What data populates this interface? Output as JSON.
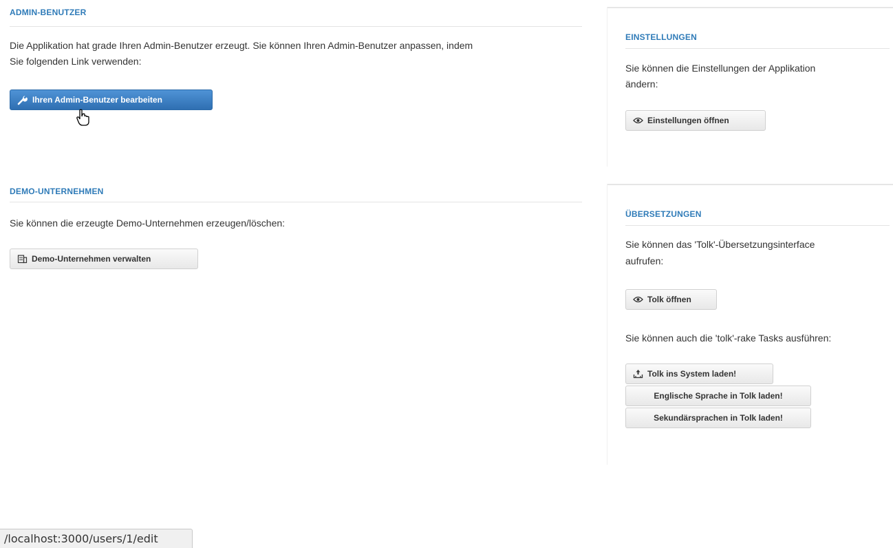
{
  "admin_section": {
    "title": "ADMIN-BENUTZER",
    "text_line1": "Die Applikation hat grade Ihren Admin-Benutzer erzeugt. Sie können Ihren Admin-Benutzer anpassen, indem",
    "text_line2": "Sie folgenden Link verwenden:",
    "button_label": "Ihren Admin-Benutzer bearbeiten",
    "button_icon": "wrench-icon"
  },
  "demo_section": {
    "title": "DEMO-UNTERNEHMEN",
    "text": "Sie können die erzeugte Demo-Unternehmen erzeugen/löschen:",
    "button_label": "Demo-Unternehmen verwalten",
    "button_icon": "company-icon"
  },
  "settings_section": {
    "title": "EINSTELLUNGEN",
    "text_line1": "Sie können die Einstellungen der Applikation",
    "text_line2": "ändern:",
    "button_label": "Einstellungen öffnen",
    "button_icon": "eye-icon"
  },
  "translations_section": {
    "title": "ÜBERSETZUNGEN",
    "text_line1": "Sie können das 'Tolk'-Übersetzungsinterface",
    "text_line2": "aufrufen:",
    "open_button_label": "Tolk öffnen",
    "open_button_icon": "eye-icon",
    "rake_text": "Sie können auch die 'tolk'-rake Tasks ausführen:",
    "load_button_label": "Tolk ins System laden!",
    "load_button_icon": "upload-icon",
    "english_button_label": "Englische Sprache in Tolk laden!",
    "secondary_button_label": "Sekundärsprachen in Tolk laden!"
  },
  "status_bar": {
    "url": "/localhost:3000/users/1/edit"
  },
  "colors": {
    "heading": "#2f7bb8",
    "primary_button": "#2f6fb2"
  }
}
